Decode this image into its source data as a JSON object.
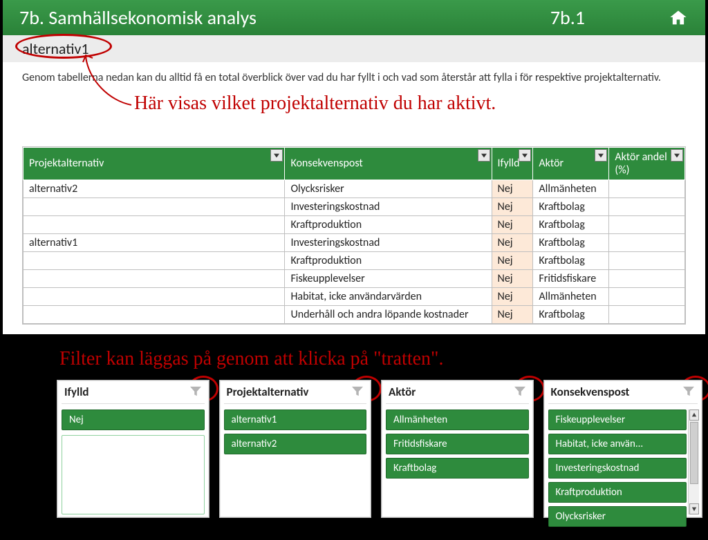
{
  "header": {
    "title": "7b. Samhällsekonomisk analys",
    "code": "7b.1"
  },
  "active_alt": "alternativ1",
  "description": "Genom tabellerna nedan kan du alltid få en total överblick över vad du har fyllt i och vad som återstår att fylla i för respektive projektalternativ.",
  "annotations": {
    "top": "Här visas vilket projektalternativ du har aktivt.",
    "mid": "Filter kan läggas på genom att klicka på \"tratten\"."
  },
  "columns": {
    "proj": "Projektalternativ",
    "kons": "Konsekvenspost",
    "ifylld": "Ifylld",
    "aktor": "Aktör",
    "andel": "Aktör andel (%)"
  },
  "rows": [
    {
      "proj": "alternativ2",
      "kons": "Olycksrisker",
      "ifylld": "Nej",
      "aktor": "Allmänheten",
      "andel": ""
    },
    {
      "proj": "",
      "kons": "Investeringskostnad",
      "ifylld": "Nej",
      "aktor": "Kraftbolag",
      "andel": ""
    },
    {
      "proj": "",
      "kons": "Kraftproduktion",
      "ifylld": "Nej",
      "aktor": "Kraftbolag",
      "andel": ""
    },
    {
      "proj": "alternativ1",
      "kons": "Investeringskostnad",
      "ifylld": "Nej",
      "aktor": "Kraftbolag",
      "andel": ""
    },
    {
      "proj": "",
      "kons": "Kraftproduktion",
      "ifylld": "Nej",
      "aktor": "Kraftbolag",
      "andel": ""
    },
    {
      "proj": "",
      "kons": "Fiskeupplevelser",
      "ifylld": "Nej",
      "aktor": "Fritidsfiskare",
      "andel": ""
    },
    {
      "proj": "",
      "kons": "Habitat, icke användarvärden",
      "ifylld": "Nej",
      "aktor": "Allmänheten",
      "andel": ""
    },
    {
      "proj": "",
      "kons": "Underhåll och andra löpande kostnader",
      "ifylld": "Nej",
      "aktor": "Kraftbolag",
      "andel": ""
    }
  ],
  "slicers": [
    {
      "title": "Ifylld",
      "items": [
        "Nej"
      ]
    },
    {
      "title": "Projektalternativ",
      "items": [
        "alternativ1",
        "alternativ2"
      ]
    },
    {
      "title": "Aktör",
      "items": [
        "Allmänheten",
        "Fritidsfiskare",
        "Kraftbolag"
      ]
    },
    {
      "title": "Konsekvenspost",
      "items": [
        "Fiskeupplevelser",
        "Habitat, icke använ...",
        "Investeringskostnad",
        "Kraftproduktion",
        "Olycksrisker"
      ]
    }
  ]
}
